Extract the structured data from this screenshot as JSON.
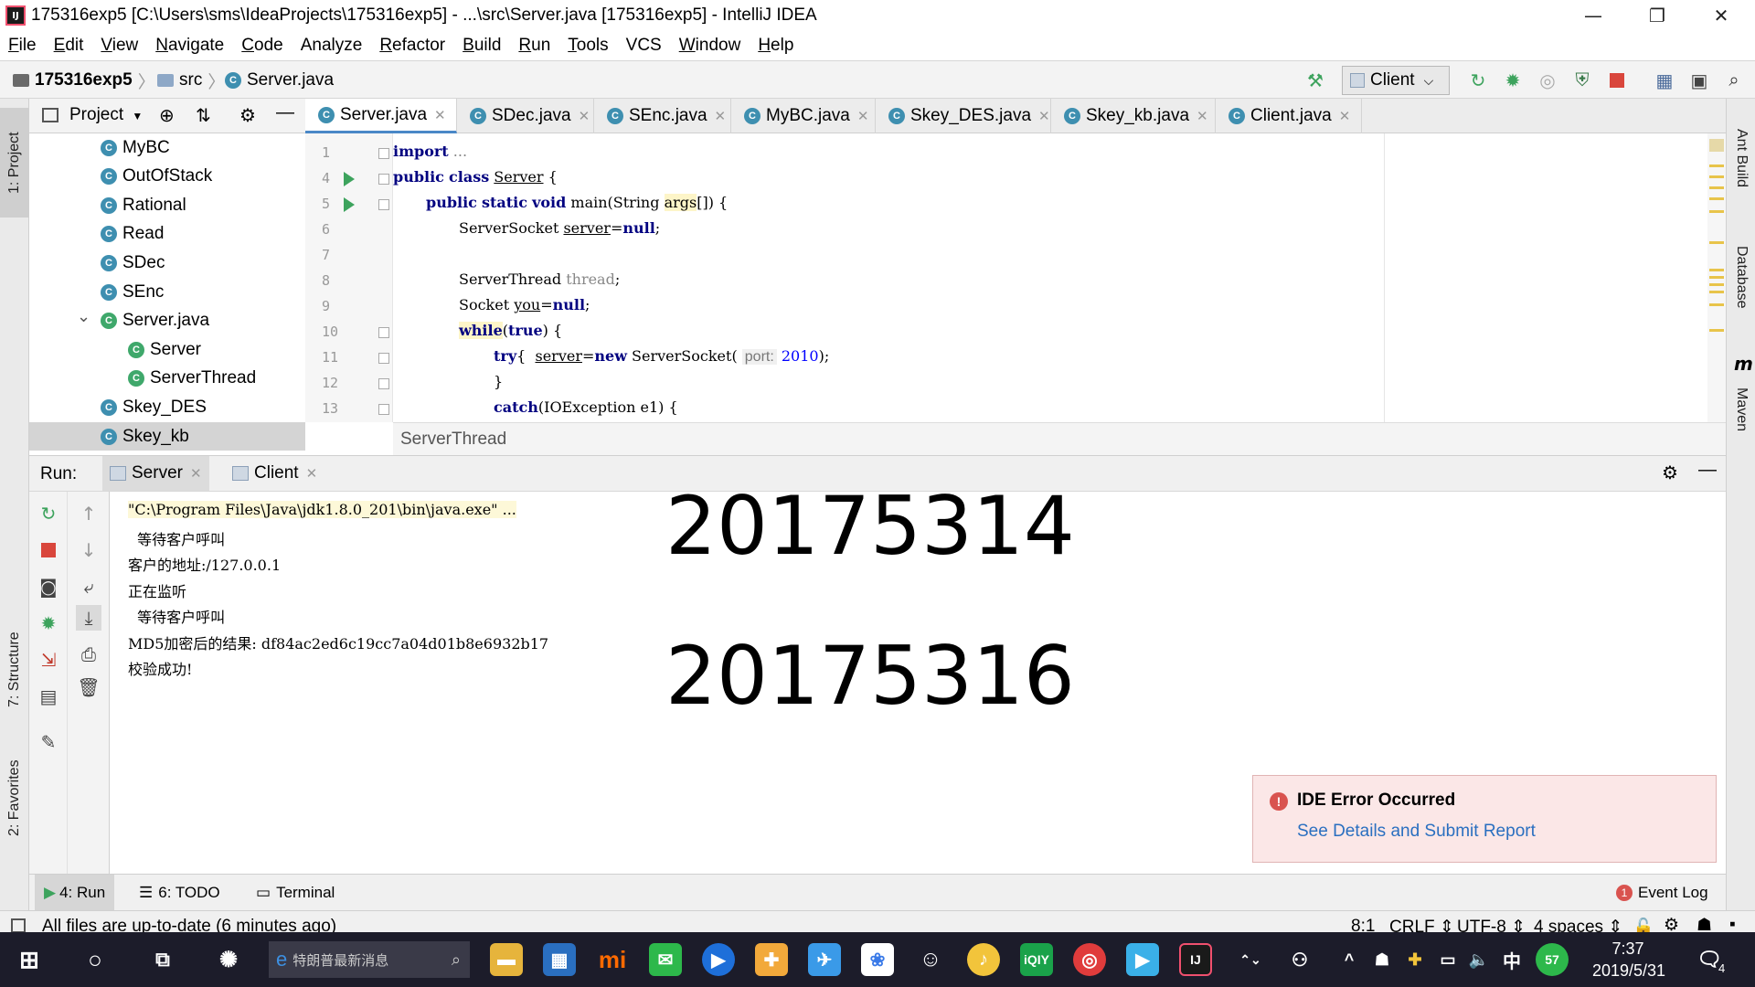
{
  "window": {
    "title": "175316exp5 [C:\\Users\\sms\\IdeaProjects\\175316exp5] - ...\\src\\Server.java [175316exp5] - IntelliJ IDEA",
    "app_icon_label": "IJ",
    "minimize": "—",
    "restore": "❐",
    "close": "✕"
  },
  "menu": {
    "items": [
      {
        "label": "File",
        "u": "F",
        "rest": "ile"
      },
      {
        "label": "Edit",
        "u": "E",
        "rest": "dit"
      },
      {
        "label": "View",
        "u": "V",
        "rest": "iew"
      },
      {
        "label": "Navigate",
        "u": "N",
        "rest": "avigate"
      },
      {
        "label": "Code",
        "u": "C",
        "rest": "ode"
      },
      {
        "label": "Analyze",
        "u": "",
        "rest": "Analyze"
      },
      {
        "label": "Refactor",
        "u": "R",
        "rest": "efactor"
      },
      {
        "label": "Build",
        "u": "B",
        "rest": "uild"
      },
      {
        "label": "Run",
        "u": "R",
        "rest": "un"
      },
      {
        "label": "Tools",
        "u": "T",
        "rest": "ools"
      },
      {
        "label": "VCS",
        "u": "",
        "rest": "VCS"
      },
      {
        "label": "Window",
        "u": "W",
        "rest": "indow"
      },
      {
        "label": "Help",
        "u": "H",
        "rest": "elp"
      }
    ]
  },
  "navbar": {
    "project": "175316exp5",
    "folder": "src",
    "file": "Server.java",
    "run_config": "Client"
  },
  "left_strip": {
    "project_tab": "1: Project",
    "structure_tab": "7: Structure",
    "favorites_tab": "2: Favorites"
  },
  "right_strip": {
    "ant_tab": "Ant Build",
    "database_tab": "Database",
    "maven_tab": "Maven",
    "maven_icon": "m"
  },
  "project_panel": {
    "title": "Project",
    "tree": [
      {
        "label": "MyBC",
        "indent": 0,
        "icon": "C",
        "expanded": null
      },
      {
        "label": "OutOfStack",
        "indent": 0,
        "icon": "C",
        "expanded": null
      },
      {
        "label": "Rational",
        "indent": 0,
        "icon": "C",
        "expanded": null
      },
      {
        "label": "Read",
        "indent": 0,
        "icon": "C",
        "expanded": null
      },
      {
        "label": "SDec",
        "indent": 0,
        "icon": "C",
        "expanded": null
      },
      {
        "label": "SEnc",
        "indent": 0,
        "icon": "C",
        "expanded": null
      },
      {
        "label": "Server.java",
        "indent": 0,
        "icon": "C",
        "expanded": true
      },
      {
        "label": "Server",
        "indent": 1,
        "icon": "C",
        "expanded": null
      },
      {
        "label": "ServerThread",
        "indent": 1,
        "icon": "C",
        "expanded": null
      },
      {
        "label": "Skey_DES",
        "indent": 0,
        "icon": "C",
        "expanded": null
      },
      {
        "label": "Skey_kb",
        "indent": 0,
        "icon": "C",
        "expanded": null,
        "selected": true
      }
    ]
  },
  "editor": {
    "tabs": [
      {
        "label": "Server.java",
        "active": true
      },
      {
        "label": "SDec.java",
        "active": false
      },
      {
        "label": "SEnc.java",
        "active": false
      },
      {
        "label": "MyBC.java",
        "active": false
      },
      {
        "label": "Skey_DES.java",
        "active": false
      },
      {
        "label": "Skey_kb.java",
        "active": false
      },
      {
        "label": "Client.java",
        "active": false
      }
    ],
    "line_numbers": [
      "1",
      "4",
      "5",
      "6",
      "7",
      "8",
      "9",
      "10",
      "11",
      "12",
      "13"
    ],
    "code": {
      "l1_kw": "import",
      "l1_rest": " ...",
      "l4_kw1": "public",
      "l4_kw2": "class",
      "l4_name": "Server",
      "l4_rest": " {",
      "l5_kw1": "public",
      "l5_kw2": "static",
      "l5_kw3": "void",
      "l5_mid": " main(String ",
      "l5_args": "args",
      "l5_end": "[]) {",
      "l6_a": "ServerSocket ",
      "l6_var": "server",
      "l6_eq": "=",
      "l6_null": "null",
      "l6_end": ";",
      "l8_a": "ServerThread ",
      "l8_var": "thread",
      "l8_end": ";",
      "l9_a": "Socket ",
      "l9_var": "you",
      "l9_eq": "=",
      "l9_null": "null",
      "l9_end": ";",
      "l10_kw": "while",
      "l10_p": "(",
      "l10_true": "true",
      "l10_end": ") {",
      "l11_kw": "try",
      "l11_b": "{  ",
      "l11_var": "server",
      "l11_eq": "=",
      "l11_new": "new",
      "l11_cls": " ServerSocket( ",
      "l11_hint": "port:",
      "l11_num": " 2010",
      "l11_end": ");",
      "l12": "}",
      "l13_kw": "catch",
      "l13_rest": "(IOException e1) {"
    },
    "breadcrumb": "ServerThread"
  },
  "run_panel": {
    "label": "Run:",
    "tabs": [
      {
        "label": "Server",
        "active": true
      },
      {
        "label": "Client",
        "active": false
      }
    ],
    "console": [
      "\"C:\\Program Files\\Java\\jdk1.8.0_201\\bin\\java.exe\" ...",
      "  等待客户呼叫",
      "客户的地址:/127.0.0.1",
      "正在监听",
      "  等待客户呼叫",
      "MD5加密后的结果: df84ac2ed6c19cc7a04d01b8e6932b17",
      "校验成功!"
    ],
    "overlay_1": "20175314",
    "overlay_2": "20175316"
  },
  "error_popup": {
    "title": "IDE Error Occurred",
    "link": "See Details and Submit Report",
    "icon": "!"
  },
  "bottom_tabs": {
    "run": "4: Run",
    "todo": "6: TODO",
    "terminal": "Terminal",
    "event_log": "Event Log",
    "event_count": "1"
  },
  "statusbar": {
    "message": "All files are up-to-date (6 minutes ago)",
    "position": "8:1",
    "line_sep": "CRLF",
    "encoding": "UTF-8",
    "indent": "4 spaces"
  },
  "taskbar": {
    "search_placeholder": "特朗普最新消息",
    "time": "7:37",
    "date": "2019/5/31",
    "ime": "中",
    "badge": "57",
    "notif_count": "4"
  },
  "colors": {
    "accent": "#4a88c7",
    "run_green": "#3da35d",
    "error_red": "#d9534f",
    "keyword": "#000080",
    "number": "#0000ff"
  }
}
